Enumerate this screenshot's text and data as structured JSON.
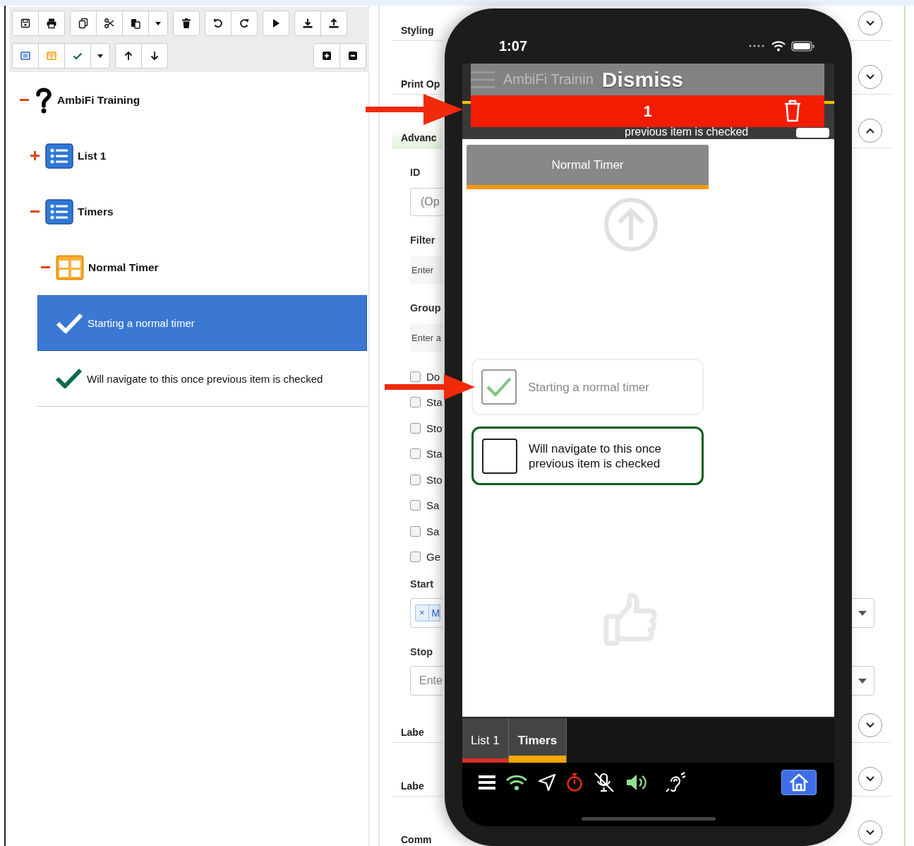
{
  "tree": [
    {
      "label": "AmbiFi Training",
      "kind": "root",
      "expanded": true,
      "selected": false,
      "children": [
        {
          "label": "List 1",
          "kind": "list",
          "expanded": false,
          "selected": false
        },
        {
          "label": "Timers",
          "kind": "list",
          "expanded": true,
          "selected": false,
          "children": [
            {
              "label": "Normal Timer",
              "kind": "group",
              "expanded": true,
              "selected": false,
              "children": [
                {
                  "label": "Starting a normal timer",
                  "kind": "check",
                  "selected": true
                },
                {
                  "label": "Will navigate to this once previous item is checked",
                  "kind": "check",
                  "selected": false
                }
              ]
            }
          ]
        }
      ]
    }
  ],
  "properties": [
    {
      "kind": "section",
      "label": "Styling",
      "expanded": false
    },
    {
      "kind": "section",
      "label": "Print Op",
      "expanded": false
    },
    {
      "kind": "section",
      "label": "Advanc",
      "expanded": true
    },
    {
      "kind": "label",
      "label": "ID"
    },
    {
      "kind": "input",
      "placeholder": "(Op"
    },
    {
      "kind": "label",
      "label": "Filter"
    },
    {
      "kind": "filled_input",
      "placeholder": "Enter"
    },
    {
      "kind": "label",
      "label": "Group"
    },
    {
      "kind": "filled_input",
      "placeholder": "Enter a"
    },
    {
      "kind": "checkbox",
      "label": "Do",
      "checked": false
    },
    {
      "kind": "checkbox",
      "label": "Sta",
      "checked": false
    },
    {
      "kind": "checkbox",
      "label": "Sto",
      "checked": false
    },
    {
      "kind": "checkbox",
      "label": "Sta",
      "checked": false
    },
    {
      "kind": "checkbox",
      "label": "Sto",
      "checked": false
    },
    {
      "kind": "checkbox",
      "label": "Sa",
      "checked": false
    },
    {
      "kind": "checkbox",
      "label": "Sa",
      "checked": false
    },
    {
      "kind": "checkbox",
      "label": "Ge",
      "checked": false
    },
    {
      "kind": "label",
      "label": "Start"
    },
    {
      "kind": "select",
      "tags": [
        {
          "remove": "×",
          "label": "M"
        }
      ]
    },
    {
      "kind": "label",
      "label": "Stop"
    },
    {
      "kind": "select",
      "placeholder": "Ente"
    },
    {
      "kind": "section",
      "label": "Labe",
      "expanded": false
    },
    {
      "kind": "section",
      "label": "Labe",
      "expanded": false
    },
    {
      "kind": "section",
      "label": "Comm",
      "expanded": false
    }
  ],
  "phone": {
    "time": "1:07",
    "app_title": "AmbiFi Trainin",
    "toast": "Dismiss",
    "alert_count": "1",
    "breadcrumb": "previous item is checked",
    "group_button": "Normal Timer",
    "items": [
      {
        "text": "Starting a normal timer",
        "checked": true,
        "selected": false
      },
      {
        "text": "Will navigate to this once previous item is checked",
        "checked": false,
        "selected": true
      }
    ],
    "tabs": [
      {
        "label": "List 1",
        "selected": false,
        "color": "#d93025"
      },
      {
        "label": "Timers",
        "selected": true,
        "color": "#f5a800"
      }
    ]
  }
}
